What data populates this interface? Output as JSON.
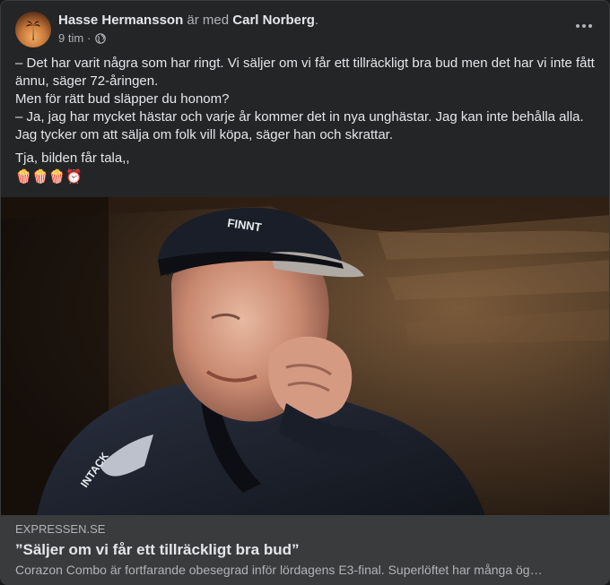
{
  "post": {
    "author": "Hasse Hermansson",
    "with_text": "är med",
    "tagged": "Carl Norberg",
    "period": ".",
    "time": "9 tim",
    "dot": "·",
    "privacy_icon": "globe-icon",
    "more_icon": "more-horizontal-icon"
  },
  "text": {
    "p1": "– Det har varit några som har ringt. Vi säljer om vi får ett tillräckligt bra bud men det har vi inte fått ännu, säger 72-åringen.",
    "p2": "Men för rätt bud släpper du honom?",
    "p3": "– Ja, jag har mycket hästar och varje år kommer det in nya unghästar. Jag kan inte behålla alla. Jag tycker om att sälja om folk vill köpa, säger han och skrattar.",
    "p4": "Tja, bilden får tala,,",
    "emojis": "🍿🍿🍿⏰"
  },
  "link": {
    "domain": "EXPRESSEN.SE",
    "title": "”Säljer om vi får ett tillräckligt bra bud”",
    "description": "Corazon Combo är fortfarande obesegrad inför lördagens E3-final. Superlöftet har många ög…",
    "photo_cap_text": "FINNT",
    "photo_jacket_text": "INTACK"
  },
  "colors": {
    "card_bg": "#242526",
    "link_bg": "#3a3b3c",
    "primary_text": "#e4e6eb",
    "secondary_text": "#b0b3b8"
  }
}
